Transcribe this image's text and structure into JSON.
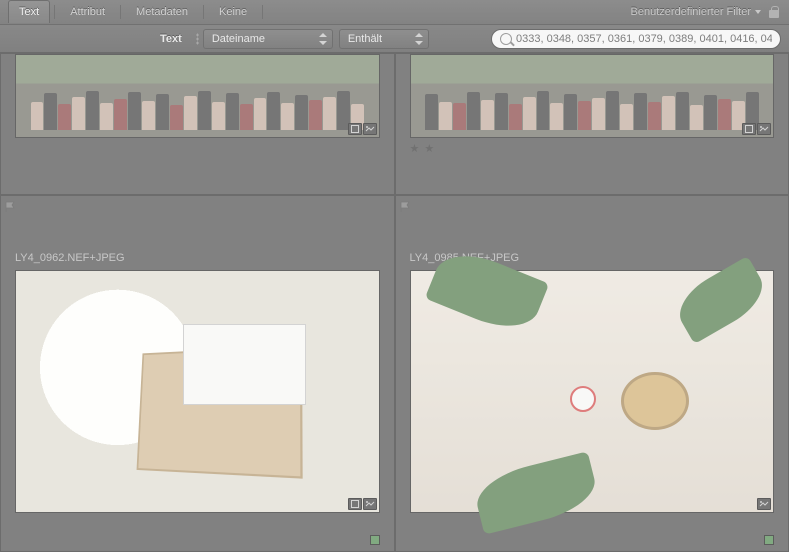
{
  "tabs": {
    "text": "Text",
    "attribute": "Attribut",
    "metadata": "Metadaten",
    "none": "Keine"
  },
  "filter_menu": {
    "label": "Benutzerdefinierter Filter"
  },
  "filterbar": {
    "label": "Text",
    "field": "Dateiname",
    "rule": "Enthält",
    "query": "0333, 0348, 0357, 0361, 0379, 0389, 0401, 0416, 04",
    "search_placeholder": ""
  },
  "cells": [
    {
      "filename": "",
      "rating": "",
      "color": "#3a7a3a"
    },
    {
      "filename": "",
      "rating": "★ ★",
      "color": "#3a7a3a"
    },
    {
      "filename": "LY4_0962.NEF+JPEG",
      "rating": "",
      "color": "#3a7a3a"
    },
    {
      "filename": "LY4_0985.NEF+JPEG",
      "rating": "",
      "color": "#3a7a3a"
    }
  ]
}
